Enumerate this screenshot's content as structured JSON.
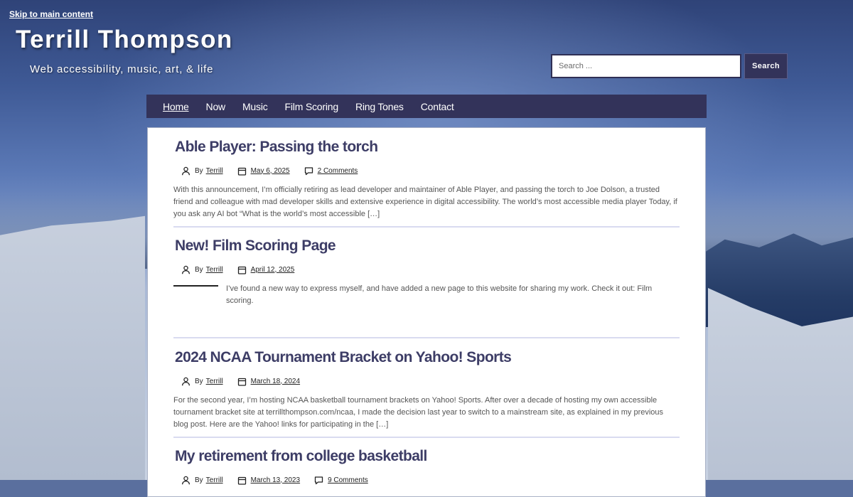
{
  "skip_link": "Skip to main content",
  "site": {
    "title": "Terrill Thompson",
    "tagline": "Web accessibility, music, art, & life"
  },
  "search": {
    "placeholder": "Search ...",
    "button_label": "Search"
  },
  "nav": {
    "items": [
      {
        "label": "Home",
        "current": true
      },
      {
        "label": "Now",
        "current": false
      },
      {
        "label": "Music",
        "current": false
      },
      {
        "label": "Film Scoring",
        "current": false
      },
      {
        "label": "Ring Tones",
        "current": false
      },
      {
        "label": "Contact",
        "current": false
      }
    ]
  },
  "posts": [
    {
      "title": "Able Player: Passing the torch",
      "by_label": "By",
      "author": "Terrill",
      "date": "May 6, 2025",
      "comments": "2 Comments",
      "excerpt": "With this announcement, I’m officially retiring as lead developer and maintainer of Able Player, and passing the torch to Joe Dolson, a trusted friend and colleague with mad developer skills and extensive experience in digital accessibility. The world’s most accessible media player Today, if you ask any AI bot “What is the world’s most accessible […]"
    },
    {
      "title": "New! Film Scoring Page",
      "by_label": "By",
      "author": "Terrill",
      "date": "April 12, 2025",
      "excerpt": "I’ve found a new way to express myself, and have added a new page to this website for sharing my work. Check it out: Film scoring."
    },
    {
      "title": "2024 NCAA Tournament Bracket on Yahoo! Sports",
      "by_label": "By",
      "author": "Terrill",
      "date": "March 18, 2024",
      "excerpt": "For the second year, I’m hosting NCAA basketball tournament brackets on Yahoo! Sports. After over a decade of hosting my own accessible tournament bracket site at terrillthompson.com/ncaa, I made the decision last year to switch to a mainstream site, as explained in my previous blog post. Here are the Yahoo! links for participating in the […]"
    },
    {
      "title": "My retirement from college basketball",
      "by_label": "By",
      "author": "Terrill",
      "date": "March 13, 2023",
      "comments": "9 Comments"
    }
  ],
  "colors": {
    "nav_bg": "#33335a",
    "title_color": "#3d3d66",
    "divider": "#d9dbf0"
  }
}
